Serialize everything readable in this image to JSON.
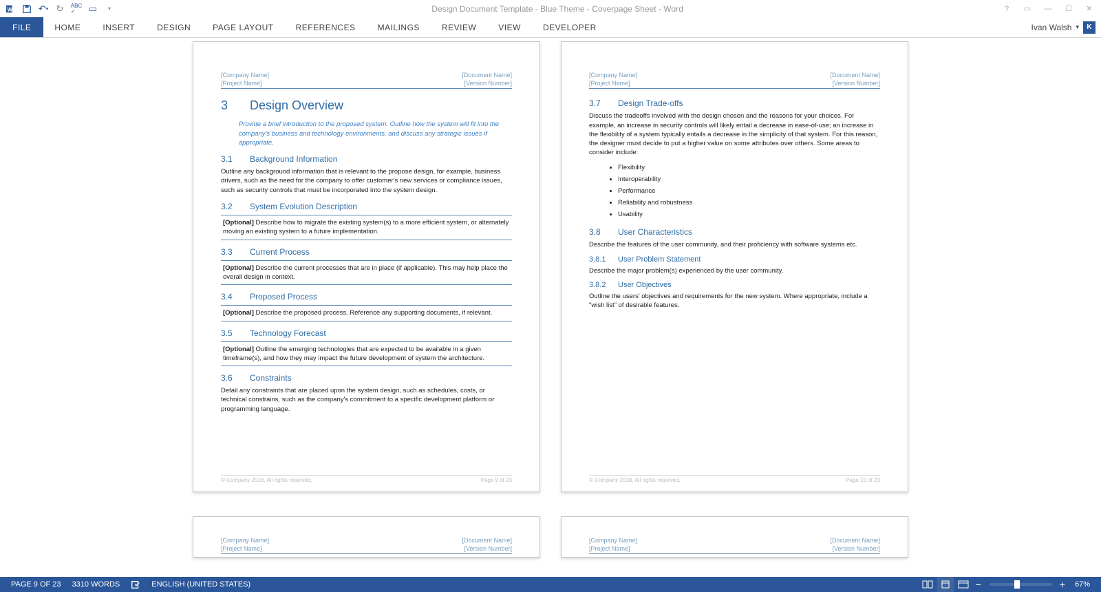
{
  "title": "Design Document Template - Blue Theme - Coverpage Sheet - Word",
  "user": {
    "name": "Ivan Walsh",
    "initial": "K"
  },
  "ribbon": {
    "tabs": [
      "FILE",
      "HOME",
      "INSERT",
      "DESIGN",
      "PAGE LAYOUT",
      "REFERENCES",
      "MAILINGS",
      "REVIEW",
      "VIEW",
      "DEVELOPER"
    ]
  },
  "doc": {
    "header": {
      "company": "[Company Name]",
      "project": "[Project Name]",
      "docname": "[Document Name]",
      "version": "[Version Number]"
    },
    "footer": {
      "copyright": "© Company 2018. All rights reserved.",
      "pageLeft": "Page 9 of 23",
      "pageRight": "Page 10 of 23"
    },
    "left": {
      "h1_num": "3",
      "h1_title": "Design Overview",
      "intro": "Provide a brief introduction to the proposed system. Outline how the system will fit into the company's business and technology environments, and discuss any strategic issues if appropriate.",
      "s31_num": "3.1",
      "s31_title": "Background Information",
      "s31_body": "Outline any background information that is relevant to the propose design, for example, business drivers, such as the need for the company to offer customer's new services or compliance issues, such as security controls that must be incorporated into the system design.",
      "s32_num": "3.2",
      "s32_title": "System Evolution Description",
      "s32_opt": "[Optional]",
      "s32_body": " Describe how to migrate the existing system(s) to a more efficient system, or alternately moving an existing system to a future implementation.",
      "s33_num": "3.3",
      "s33_title": "Current Process",
      "s33_opt": "[Optional]",
      "s33_body": " Describe the current processes that are in place (if applicable). This may help place the overall design in context.",
      "s34_num": "3.4",
      "s34_title": "Proposed Process",
      "s34_opt": "[Optional]",
      "s34_body": " Describe the proposed process. Reference any supporting documents, if relevant.",
      "s35_num": "3.5",
      "s35_title": "Technology Forecast",
      "s35_opt": "[Optional]",
      "s35_body": " Outline the emerging technologies that are expected to be available in a given timeframe(s), and how they may impact the future development of system the architecture.",
      "s36_num": "3.6",
      "s36_title": "Constraints",
      "s36_body": "Detail any constraints that are placed upon the system design, such as schedules, costs, or technical constrains, such as the company's commitment to a specific development platform or programming language."
    },
    "right": {
      "s37_num": "3.7",
      "s37_title": "Design Trade-offs",
      "s37_body": "Discuss the tradeoffs involved with the design chosen and the reasons for your choices. For example, an increase in security controls will likely entail a decrease in ease-of-use; an increase in the flexibility of a system typically entails a decrease in the simplicity of that system. For this reason, the designer must decide to put a higher value on some attributes over others. Some areas to consider include:",
      "bullets": [
        "Flexibility",
        "Interoperability",
        "Performance",
        "Reliability and robustness",
        "Usability"
      ],
      "s38_num": "3.8",
      "s38_title": "User Characteristics",
      "s38_body": "Describe the features of the user community, and their proficiency with software systems etc.",
      "s381_num": "3.8.1",
      "s381_title": "User Problem Statement",
      "s381_body": "Describe the major problem(s) experienced by the user community.",
      "s382_num": "3.8.2",
      "s382_title": "User Objectives",
      "s382_body": "Outline the users' objectives and requirements for the new system. Where appropriate, include a \"wish list\" of desirable features."
    }
  },
  "status": {
    "page": "PAGE 9 OF 23",
    "words": "3310 WORDS",
    "lang": "ENGLISH (UNITED STATES)",
    "zoom": "67%",
    "minus": "−",
    "plus": "+"
  }
}
